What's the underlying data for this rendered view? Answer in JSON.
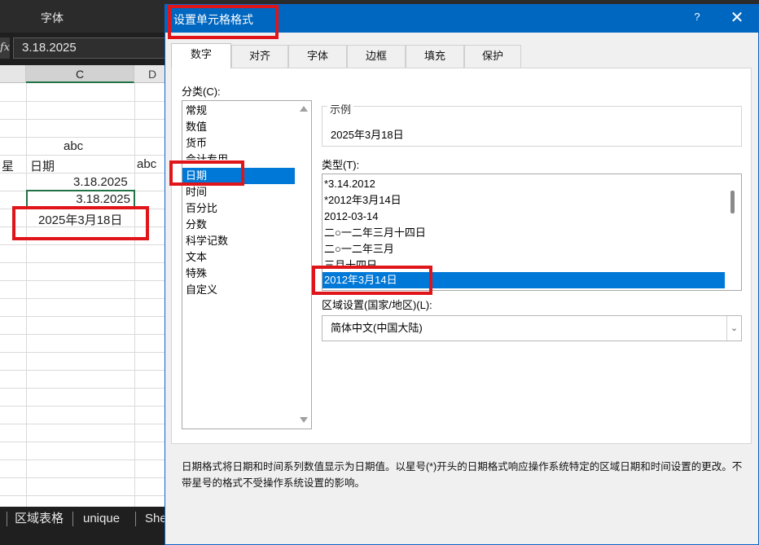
{
  "excel": {
    "ribbon_group_label": "字体",
    "formula_value": "3.18.2025",
    "columns": [
      "C",
      "D"
    ],
    "cells": {
      "header_abc": "abc",
      "header_xing": "星",
      "header_riqi": "日期",
      "header_abc_d": "abc",
      "c4": "3.18.2025",
      "c5": "3.18.2025",
      "c6": "2025年3月18日"
    },
    "sheet_tabs": [
      "区域表格",
      "unique",
      "She"
    ]
  },
  "dialog": {
    "title": "设置单元格格式",
    "help": "?",
    "close": "✕",
    "tabs": [
      "数字",
      "对齐",
      "字体",
      "边框",
      "填充",
      "保护"
    ],
    "active_tab": "数字",
    "category_label": "分类(C):",
    "categories": [
      "常规",
      "数值",
      "货币",
      "会计专用",
      "日期",
      "时间",
      "百分比",
      "分数",
      "科学记数",
      "文本",
      "特殊",
      "自定义"
    ],
    "selected_category": "日期",
    "sample_label": "示例",
    "sample_value": "2025年3月18日",
    "type_label": "类型(T):",
    "types": [
      "*3.14.2012",
      "*2012年3月14日",
      "2012-03-14",
      "二○一二年三月十四日",
      "二○一二年三月",
      "三月十四日",
      "2012年3月14日"
    ],
    "selected_type": "2012年3月14日",
    "locale_label": "区域设置(国家/地区)(L):",
    "locale_value": "简体中文(中国大陆)",
    "description": "日期格式将日期和时间系列数值显示为日期值。以星号(*)开头的日期格式响应操作系统特定的区域日期和时间设置的更改。不带星号的格式不受操作系统设置的影响。"
  },
  "colors": {
    "title_bar": "#0067c0",
    "selection": "#0078d7",
    "highlight_box": "#e0151a",
    "excel_selection": "#217346"
  }
}
